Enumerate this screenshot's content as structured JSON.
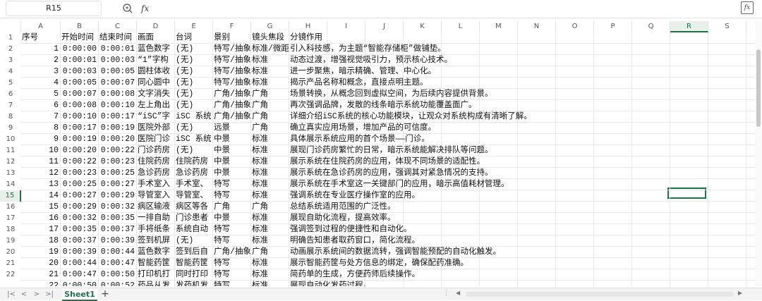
{
  "formula_bar": {
    "cell_ref": "R15",
    "fx": "fx",
    "content": ""
  },
  "columns": [
    "A",
    "B",
    "C",
    "D",
    "E",
    "F",
    "G",
    "H",
    "I",
    "J",
    "K",
    "L",
    "M",
    "N",
    "O",
    "P",
    "Q",
    "R",
    "S"
  ],
  "active_column": "R",
  "active_row": 15,
  "row_numbers": [
    1,
    2,
    3,
    4,
    5,
    6,
    7,
    8,
    9,
    10,
    11,
    12,
    13,
    14,
    15,
    16,
    17,
    18,
    19,
    20,
    21,
    22
  ],
  "rows": [
    {
      "a": "序号",
      "b": "开始时间",
      "c": "结束时间",
      "d": "画面",
      "e": "台词",
      "f": "景别",
      "g": "镜头焦段",
      "h": "分镜作用"
    },
    {
      "a": "1",
      "b": "0:00:00",
      "c": "0:00:01",
      "d": "蓝色数字",
      "e": "(无)",
      "f": "特写/抽象",
      "g": "标准/微距",
      "h": "引入科技感，为主题“智能存储柜”做铺垫。"
    },
    {
      "a": "2",
      "b": "0:00:01",
      "c": "0:00:03",
      "d": "“1”字构",
      "e": "(无)",
      "f": "特写/抽象",
      "g": "标准",
      "h": "动态过渡，增强视觉吸引力，预示核心技术。"
    },
    {
      "a": "3",
      "b": "0:00:03",
      "c": "0:00:05",
      "d": "圆柱体收",
      "e": "(无)",
      "f": "特写/抽象",
      "g": "标准",
      "h": "进一步聚焦，暗示精确、管理、中心化。"
    },
    {
      "a": "4",
      "b": "0:00:05",
      "c": "0:00:07",
      "d": "同心圆中",
      "e": "(无)",
      "f": "特写/抽象",
      "g": "标准",
      "h": "揭示产品名称和概念，直接点明主题。"
    },
    {
      "a": "5",
      "b": "0:00:07",
      "c": "0:00:08",
      "d": "文字消失",
      "e": "(无)",
      "f": "广角/抽象",
      "g": "广角",
      "h": "场景转换，从概念回到虚拟空间，为后续内容提供背景。"
    },
    {
      "a": "6",
      "b": "0:00:08",
      "c": "0:00:10",
      "d": "左上角出",
      "e": "(无)",
      "f": "广角/抽象",
      "g": "广角",
      "h": "再次强调品牌，发散的线条暗示系统功能覆盖面广。"
    },
    {
      "a": "7",
      "b": "0:00:10",
      "c": "0:00:17",
      "d": "“iSC”字",
      "e": "iSC 系统",
      "f": "广角/抽象",
      "g": "广角",
      "h": "详细介绍iSC系统的核心功能模块，让观众对系统构成有清晰了解。"
    },
    {
      "a": "8",
      "b": "0:00:17",
      "c": "0:00:19",
      "d": "医院外部",
      "e": "(无)",
      "f": "远景",
      "g": "广角",
      "h": "确立真实应用场景，增加产品的可信度。"
    },
    {
      "a": "9",
      "b": "0:00:19",
      "c": "0:00:20",
      "d": "医院门诊",
      "e": "iSC 系统",
      "f": "中景",
      "g": "标准",
      "h": "具体展示系统应用的首个场景——门诊。"
    },
    {
      "a": "10",
      "b": "0:00:20",
      "c": "0:00:22",
      "d": "门诊药房",
      "e": "(无)",
      "f": "中景",
      "g": "标准",
      "h": "展现门诊药房繁忙的日常，暗示系统能解决排队等问题。"
    },
    {
      "a": "11",
      "b": "0:00:22",
      "c": "0:00:23",
      "d": "住院药房",
      "e": "住院药房",
      "f": "中景",
      "g": "标准",
      "h": "展示系统在住院药房的应用，体现不同场景的适配性。"
    },
    {
      "a": "12",
      "b": "0:00:23",
      "c": "0:00:25",
      "d": "急诊药房",
      "e": "急诊药房",
      "f": "中景",
      "g": "标准",
      "h": "展示系统在急诊药房的应用，强调其对紧急情况的支持。"
    },
    {
      "a": "13",
      "b": "0:00:25",
      "c": "0:00:27",
      "d": "手术室入",
      "e": "手术室、",
      "f": "特写",
      "g": "标准",
      "h": "展示系统在手术室这一关键部门的应用，暗示高值耗材管理。"
    },
    {
      "a": "14",
      "b": "0:00:27",
      "c": "0:00:29",
      "d": "导管室入",
      "e": "导管室、",
      "f": "特写",
      "g": "标准",
      "h": "强调系统在专业医疗操作室的应用。"
    },
    {
      "a": "15",
      "b": "0:00:29",
      "c": "0:00:32",
      "d": "病区输液",
      "e": "病区等各",
      "f": "广角",
      "g": "广角",
      "h": "总结系统适用范围的广泛性。"
    },
    {
      "a": "16",
      "b": "0:00:32",
      "c": "0:00:35",
      "d": "一排自助",
      "e": "门诊患者",
      "f": "中景",
      "g": "标准",
      "h": "展现自助化流程，提高效率。"
    },
    {
      "a": "17",
      "b": "0:00:35",
      "c": "0:00:37",
      "d": "手将纸条",
      "e": "系统自动",
      "f": "特写",
      "g": "标准",
      "h": "强调签到过程的便捷性和自动化。"
    },
    {
      "a": "18",
      "b": "0:00:37",
      "c": "0:00:39",
      "d": "签到机屏",
      "e": "(无)",
      "f": "特写",
      "g": "标准",
      "h": "明确告知患者取药窗口，简化流程。"
    },
    {
      "a": "19",
      "b": "0:00:39",
      "c": "0:00:44",
      "d": "蓝色数字",
      "e": "签到后自",
      "f": "广角/抽象",
      "g": "广角",
      "h": "动画展示系统间的数据流转，强调智能预配的自动化触发。"
    },
    {
      "a": "20",
      "b": "0:00:44",
      "c": "0:00:47",
      "d": "智能药筐",
      "e": "智能药筐",
      "f": "特写",
      "g": "标准",
      "h": "展示智能药筐与处方信息的绑定，确保配药准确。"
    },
    {
      "a": "21",
      "b": "0:00:47",
      "c": "0:00:50",
      "d": "打印机打",
      "e": "同时打印",
      "f": "特写",
      "g": "标准",
      "h": "简药单的生成，方便药师后续操作。"
    },
    {
      "a": "22",
      "b": "0:00:50",
      "c": "0:00:52",
      "d": "药品从发",
      "e": "发药机发",
      "f": "特写",
      "g": "标准",
      "h": "展现自动化发药过程。"
    }
  ],
  "sheet_nav": [
    "|<",
    "<",
    ">",
    ">|"
  ],
  "sheet_tab": "Sheet1",
  "add_sheet": "+"
}
